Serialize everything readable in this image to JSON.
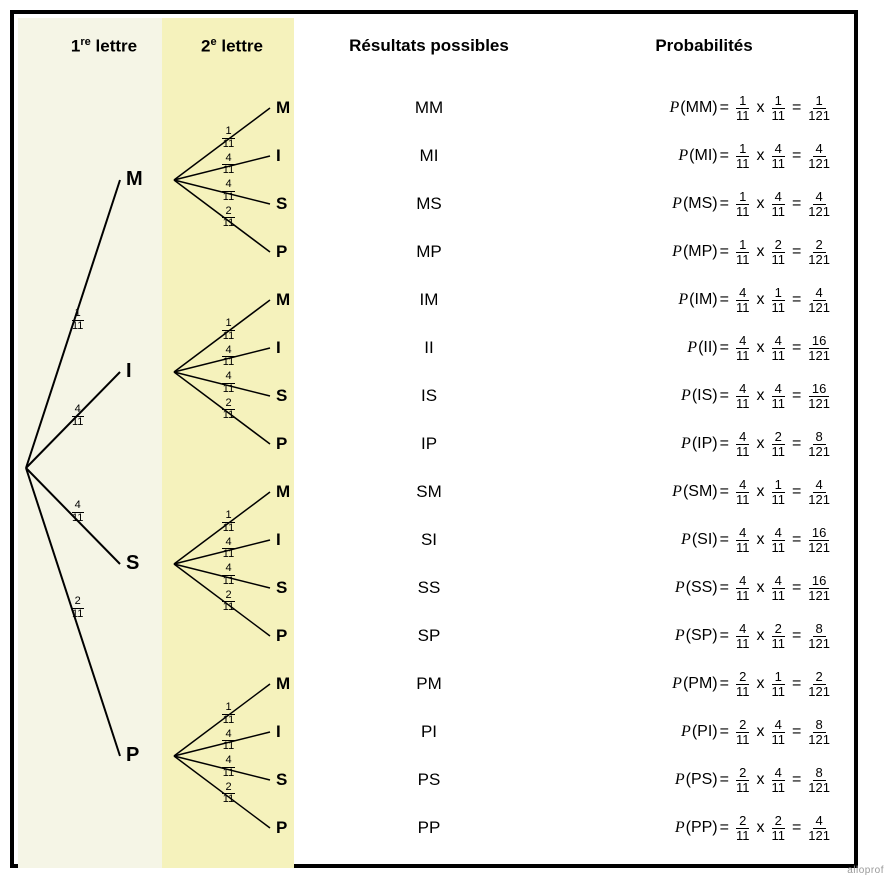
{
  "headers": {
    "col1_pre": "1",
    "col1_sup": "re",
    "col1_post": " lettre",
    "col2_pre": "2",
    "col2_sup": "e",
    "col2_post": " lettre",
    "col3": "Résultats possibles",
    "col4": "Probabilités"
  },
  "firstLevel": [
    {
      "letter": "M",
      "num": "1",
      "den": "11"
    },
    {
      "letter": "I",
      "num": "4",
      "den": "11"
    },
    {
      "letter": "S",
      "num": "4",
      "den": "11"
    },
    {
      "letter": "P",
      "num": "2",
      "den": "11"
    }
  ],
  "secondLevel": [
    {
      "letter": "M",
      "num": "1",
      "den": "11"
    },
    {
      "letter": "I",
      "num": "4",
      "den": "11"
    },
    {
      "letter": "S",
      "num": "4",
      "den": "11"
    },
    {
      "letter": "P",
      "num": "2",
      "den": "11"
    }
  ],
  "rows": [
    {
      "res": "MM",
      "a": "1",
      "b": "1",
      "rn": "1",
      "rd": "121"
    },
    {
      "res": "MI",
      "a": "1",
      "b": "4",
      "rn": "4",
      "rd": "121"
    },
    {
      "res": "MS",
      "a": "1",
      "b": "4",
      "rn": "4",
      "rd": "121"
    },
    {
      "res": "MP",
      "a": "1",
      "b": "2",
      "rn": "2",
      "rd": "121"
    },
    {
      "res": "IM",
      "a": "4",
      "b": "1",
      "rn": "4",
      "rd": "121"
    },
    {
      "res": "II",
      "a": "4",
      "b": "4",
      "rn": "16",
      "rd": "121"
    },
    {
      "res": "IS",
      "a": "4",
      "b": "4",
      "rn": "16",
      "rd": "121"
    },
    {
      "res": "IP",
      "a": "4",
      "b": "2",
      "rn": "8",
      "rd": "121"
    },
    {
      "res": "SM",
      "a": "4",
      "b": "1",
      "rn": "4",
      "rd": "121"
    },
    {
      "res": "SI",
      "a": "4",
      "b": "4",
      "rn": "16",
      "rd": "121"
    },
    {
      "res": "SS",
      "a": "4",
      "b": "4",
      "rn": "16",
      "rd": "121"
    },
    {
      "res": "SP",
      "a": "4",
      "b": "2",
      "rn": "8",
      "rd": "121"
    },
    {
      "res": "PM",
      "a": "2",
      "b": "1",
      "rn": "2",
      "rd": "121"
    },
    {
      "res": "PI",
      "a": "2",
      "b": "4",
      "rn": "8",
      "rd": "121"
    },
    {
      "res": "PS",
      "a": "2",
      "b": "4",
      "rn": "8",
      "rd": "121"
    },
    {
      "res": "PP",
      "a": "2",
      "b": "2",
      "rn": "4",
      "rd": "121"
    }
  ],
  "symbols": {
    "P": "P",
    "open": "(",
    "close": ")",
    "eq": " = ",
    "mul": " x "
  },
  "denom11": "11",
  "credit": "alloprof",
  "chart_data": {
    "type": "tree",
    "title": "Arbre des probabilités — tirage de 2 lettres du mot MISSISSIPPI (avec remise)",
    "levels": [
      {
        "name": "1re lettre",
        "branches": [
          {
            "label": "M",
            "p": "1/11"
          },
          {
            "label": "I",
            "p": "4/11"
          },
          {
            "label": "S",
            "p": "4/11"
          },
          {
            "label": "P",
            "p": "2/11"
          }
        ]
      },
      {
        "name": "2e lettre",
        "branches": [
          {
            "label": "M",
            "p": "1/11"
          },
          {
            "label": "I",
            "p": "4/11"
          },
          {
            "label": "S",
            "p": "4/11"
          },
          {
            "label": "P",
            "p": "2/11"
          }
        ]
      }
    ],
    "outcomes": [
      {
        "outcome": "MM",
        "probability": "1/121"
      },
      {
        "outcome": "MI",
        "probability": "4/121"
      },
      {
        "outcome": "MS",
        "probability": "4/121"
      },
      {
        "outcome": "MP",
        "probability": "2/121"
      },
      {
        "outcome": "IM",
        "probability": "4/121"
      },
      {
        "outcome": "II",
        "probability": "16/121"
      },
      {
        "outcome": "IS",
        "probability": "16/121"
      },
      {
        "outcome": "IP",
        "probability": "8/121"
      },
      {
        "outcome": "SM",
        "probability": "4/121"
      },
      {
        "outcome": "SI",
        "probability": "16/121"
      },
      {
        "outcome": "SS",
        "probability": "16/121"
      },
      {
        "outcome": "SP",
        "probability": "8/121"
      },
      {
        "outcome": "PM",
        "probability": "2/121"
      },
      {
        "outcome": "PI",
        "probability": "8/121"
      },
      {
        "outcome": "PS",
        "probability": "8/121"
      },
      {
        "outcome": "PP",
        "probability": "4/121"
      }
    ]
  }
}
